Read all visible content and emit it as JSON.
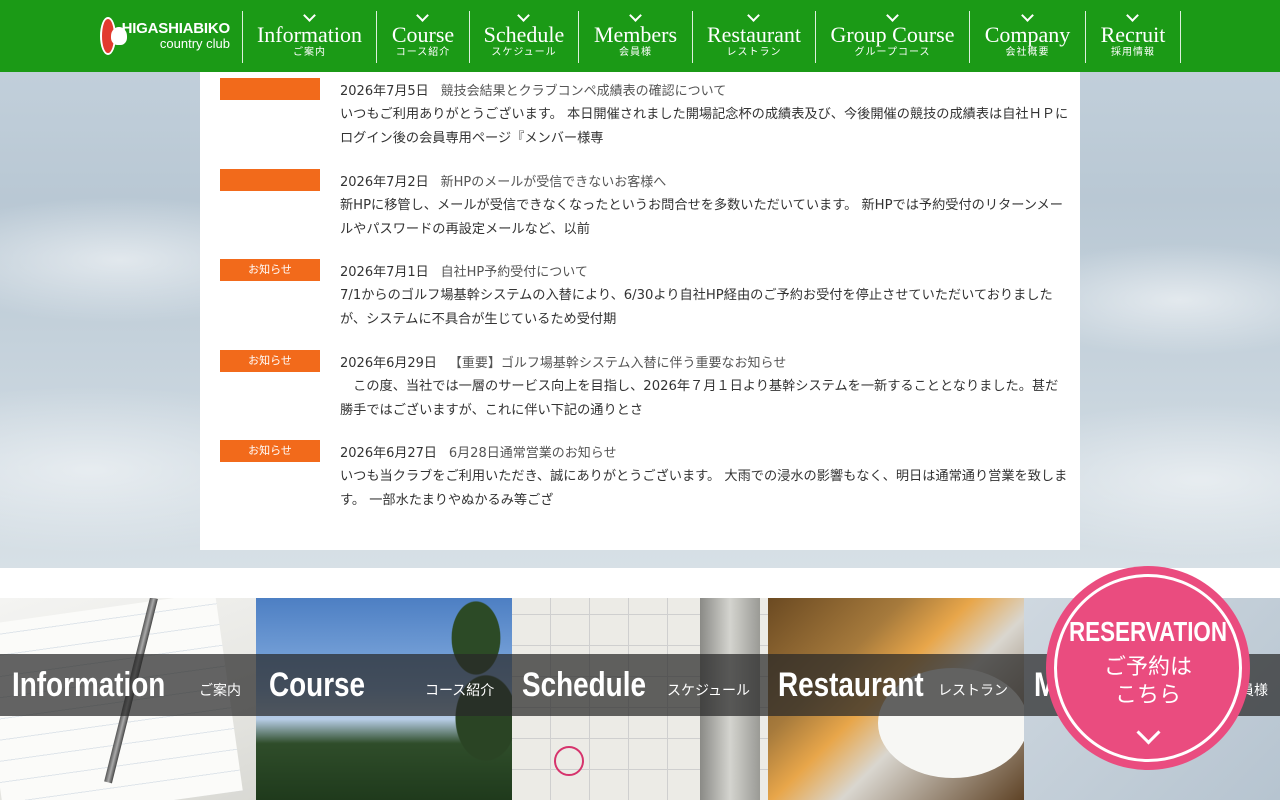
{
  "header": {
    "logo_line1": "HIGASHIABIKO",
    "logo_line2": "country club",
    "nav": [
      {
        "en": "Information",
        "ja": "ご案内"
      },
      {
        "en": "Course",
        "ja": "コース紹介"
      },
      {
        "en": "Schedule",
        "ja": "スケジュール"
      },
      {
        "en": "Members",
        "ja": "会員様"
      },
      {
        "en": "Restaurant",
        "ja": "レストラン"
      },
      {
        "en": "Group Course",
        "ja": "グループコース"
      },
      {
        "en": "Company",
        "ja": "会社概要"
      },
      {
        "en": "Recruit",
        "ja": "採用情報"
      }
    ]
  },
  "news": [
    {
      "tag": "",
      "date": "2026年7月5日",
      "title": "競技会結果とクラブコンペ成績表の確認について",
      "excerpt": "いつもご利用ありがとうございます。 本日開催されました開場記念杯の成績表及び、今後開催の競技の成績表は自社ＨＰにログイン後の会員専用ページ『メンバー様専"
    },
    {
      "tag": "",
      "date": "2026年7月2日",
      "title": "新HPのメールが受信できないお客様へ",
      "excerpt": "新HPに移管し、メールが受信できなくなったというお問合せを多数いただいています。 新HPでは予約受付のリターンメールやパスワードの再設定メールなど、以前"
    },
    {
      "tag": "お知らせ",
      "date": "2026年7月1日",
      "title": "自社HP予約受付について",
      "excerpt": "7/1からのゴルフ場基幹システムの入替により、6/30より自社HP経由のご予約お受付を停止させていただいておりましたが、システムに不具合が生じているため受付期"
    },
    {
      "tag": "お知らせ",
      "date": "2026年6月29日",
      "title": "【重要】ゴルフ場基幹システム入替に伴う重要なお知らせ",
      "excerpt": "　この度、当社では一層のサービス向上を目指し、2026年７月１日より基幹システムを一新することとなりました。甚だ勝手ではございますが、これに伴い下記の通りとさ"
    },
    {
      "tag": "お知らせ",
      "date": "2026年6月27日",
      "title": "6月28日通常営業のお知らせ",
      "excerpt": "いつも当クラブをご利用いただき、誠にありがとうございます。 大雨での浸水の影響もなく、明日は通常通り営業を致します。 一部水たまりやぬかるみ等ござ"
    }
  ],
  "banners": [
    {
      "en": "Information",
      "ja": "ご案内"
    },
    {
      "en": "Course",
      "ja": "コース紹介"
    },
    {
      "en": "Schedule",
      "ja": "スケジュール"
    },
    {
      "en": "Restaurant",
      "ja": "レストラン"
    },
    {
      "en": "M",
      "ja": "員様"
    }
  ],
  "reservation": {
    "en": "RESERVATION",
    "ja_line1": "ご予約は",
    "ja_line2": "こちら"
  },
  "colors": {
    "nav_green": "#1b9a16",
    "tag_orange": "#f26a1b",
    "reserve_pink": "#ea4c7f"
  }
}
